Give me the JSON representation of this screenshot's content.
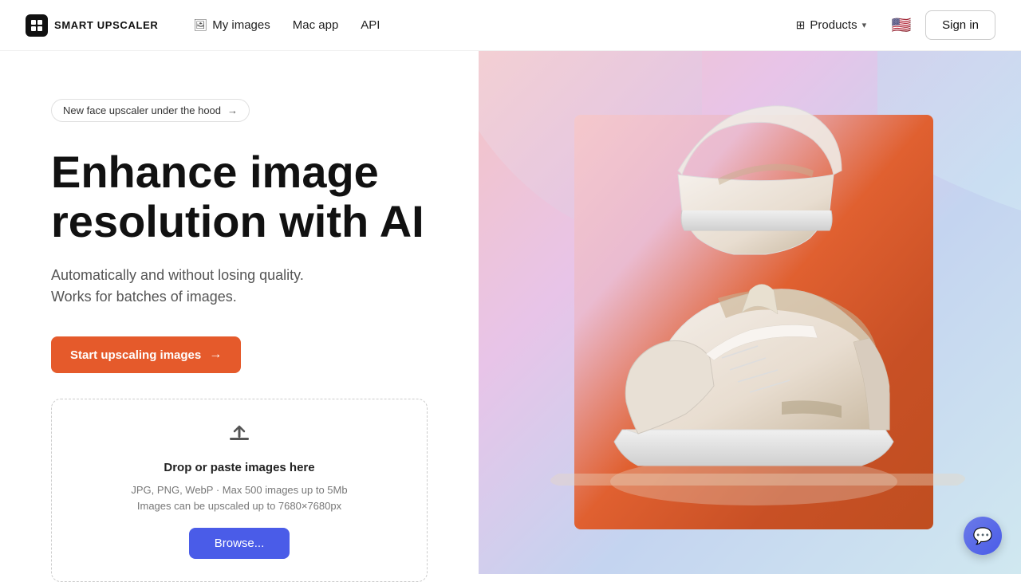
{
  "nav": {
    "logo_text": "SMART UPSCALER",
    "links": [
      {
        "id": "my-images",
        "label": "My images",
        "icon": "🖼"
      },
      {
        "id": "mac-app",
        "label": "Mac app",
        "icon": ""
      },
      {
        "id": "api",
        "label": "API",
        "icon": ""
      }
    ],
    "products_label": "Products",
    "flag_emoji": "🇺🇸",
    "signin_label": "Sign in"
  },
  "hero": {
    "badge_text": "New face upscaler under the hood",
    "badge_arrow": "→",
    "title_line1": "Enhance image",
    "title_line2": "resolution with AI",
    "subtitle_line1": "Automatically and without losing quality.",
    "subtitle_line2": "Works for batches of images.",
    "cta_label": "Start upscaling images",
    "cta_arrow": "→"
  },
  "upload": {
    "icon": "⬆",
    "title": "Drop or paste images here",
    "subtitle_line1": "JPG, PNG, WebP · Max 500 images up to 5Mb",
    "subtitle_line2": "Images can be upscaled up to 7680×7680px",
    "browse_label": "Browse..."
  },
  "chat": {
    "icon": "💬"
  }
}
